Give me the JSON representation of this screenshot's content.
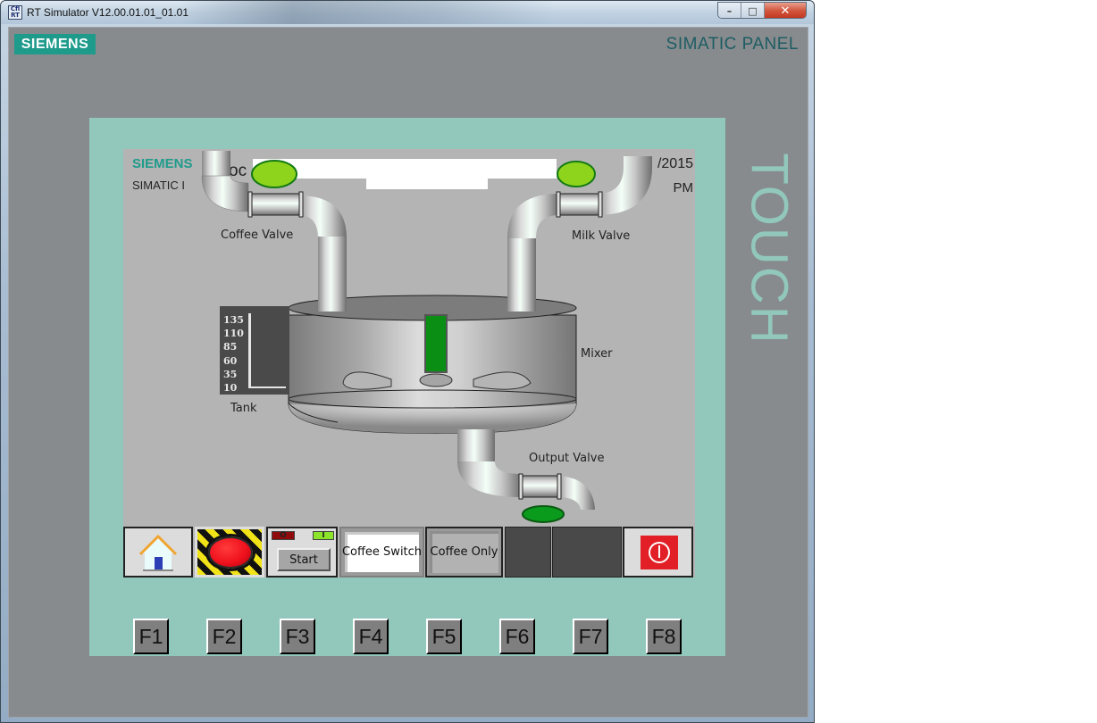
{
  "window": {
    "title": "RT Simulator V12.00.01.01_01.01",
    "app_icon": "wincc-rt-icon",
    "controls": {
      "minimize": "–",
      "maximize": "□",
      "close": "✕"
    }
  },
  "panel": {
    "brand_logo": "SIEMENS",
    "model_label": "SIMATIC PANEL",
    "side_label": "TOUCH",
    "function_keys": [
      "F1",
      "F2",
      "F3",
      "F4",
      "F5",
      "F6",
      "F7",
      "F8"
    ]
  },
  "hmi": {
    "header": {
      "brand": "SIEMENS",
      "product": "SIMATIC I",
      "screen_title_partial": "oc      en",
      "date_partial": "/2015",
      "time_partial": "PM"
    },
    "process": {
      "coffee_valve": {
        "label": "Coffee Valve",
        "state": "open",
        "indicator_color": "#8fd41c"
      },
      "milk_valve": {
        "label": "Milk Valve",
        "state": "open",
        "indicator_color": "#8fd41c"
      },
      "output_valve": {
        "label": "Output Valve",
        "state": "closed",
        "indicator_color": "#0a9a1c"
      },
      "mixer": {
        "label": "Mixer",
        "motor_indicator_color": "#0a8f14"
      },
      "tank": {
        "label": "Tank",
        "scale_ticks": [
          "135",
          "110",
          "85",
          "60",
          "35",
          "10"
        ],
        "level": 10
      }
    },
    "buttons": {
      "home": {
        "icon": "home-icon"
      },
      "emergency_stop": {
        "icon": "emergency-stop-icon"
      },
      "start_group": {
        "off_indicator": "O",
        "on_indicator": "I",
        "start_label": "Start"
      },
      "coffee_switch": {
        "label": "Coffee Switch"
      },
      "coffee_only": {
        "label": "Coffee Only"
      },
      "power": {
        "icon": "power-icon"
      }
    }
  }
}
